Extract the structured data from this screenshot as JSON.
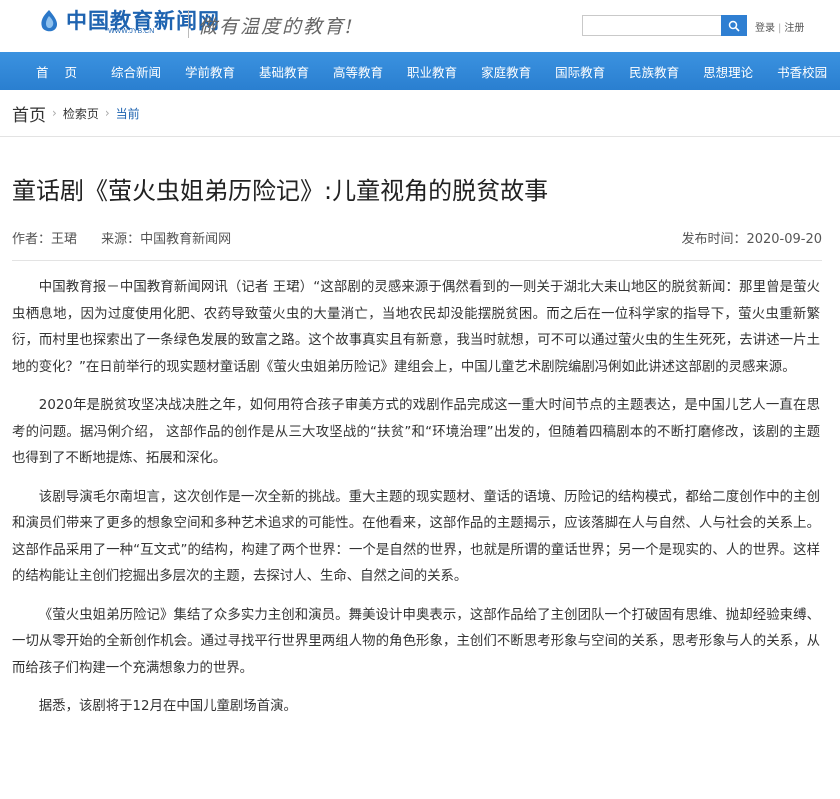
{
  "header": {
    "logo_text": "中国教育新闻网",
    "logo_sub": "WWW.JYB.CN",
    "slogan": "做有温度的教育!",
    "search_placeholder": "",
    "login": "登录",
    "register": "注册"
  },
  "nav": {
    "items": [
      "首 页",
      "综合新闻",
      "学前教育",
      "基础教育",
      "高等教育",
      "职业教育",
      "家庭教育",
      "国际教育",
      "民族教育",
      "思想理论",
      "书香校园"
    ]
  },
  "breadcrumb": {
    "home": "首页",
    "search_page": "检索页",
    "current": "当前"
  },
  "article": {
    "title": "童话剧《萤火虫姐弟历险记》:儿童视角的脱贫故事",
    "author": "作者：王珺",
    "source": "来源：中国教育新闻网",
    "published": "发布时间：2020-09-20",
    "paragraphs": [
      "中国教育报－中国教育新闻网讯（记者 王珺）“这部剧的灵感来源于偶然看到的一则关于湖北大耒山地区的脱贫新闻：那里曾是萤火虫栖息地，因为过度使用化肥、农药导致萤火虫的大量消亡，当地农民却没能摆脱贫困。而之后在一位科学家的指导下，萤火虫重新繁衍，而村里也探索出了一条绿色发展的致富之路。这个故事真实且有新意，我当时就想，可不可以通过萤火虫的生生死死，去讲述一片土地的变化？”在日前举行的现实题材童话剧《萤火虫姐弟历险记》建组会上，中国儿童艺术剧院编剧冯俐如此讲述这部剧的灵感来源。",
      "2020年是脱贫攻坚决战决胜之年，如何用符合孩子审美方式的戏剧作品完成这一重大时间节点的主题表达，是中国儿艺人一直在思考的问题。据冯俐介绍， 这部作品的创作是从三大攻坚战的“扶贫”和“环境治理”出发的，但随着四稿剧本的不断打磨修改，该剧的主题也得到了不断地提炼、拓展和深化。",
      "该剧导演毛尔南坦言，这次创作是一次全新的挑战。重大主题的现实题材、童话的语境、历险记的结构模式，都给二度创作中的主创和演员们带来了更多的想象空间和多种艺术追求的可能性。在他看来，这部作品的主题揭示，应该落脚在人与自然、人与社会的关系上。这部作品采用了一种“互文式”的结构，构建了两个世界：一个是自然的世界，也就是所谓的童话世界；另一个是现实的、人的世界。这样的结构能让主创们挖掘出多层次的主题，去探讨人、生命、自然之间的关系。",
      "《萤火虫姐弟历险记》集结了众多实力主创和演员。舞美设计申奥表示，这部作品给了主创团队一个打破固有思维、抛却经验束缚、一切从零开始的全新创作机会。通过寻找平行世界里两组人物的角色形象，主创们不断思考形象与空间的关系，思考形象与人的关系，从而给孩子们构建一个充满想象力的世界。",
      "据悉，该剧将于12月在中国儿童剧场首演。"
    ]
  },
  "colors": {
    "nav_bg": "#2e86d6",
    "brand_blue": "#1e63b0",
    "search_btn": "#2f7fd2"
  }
}
